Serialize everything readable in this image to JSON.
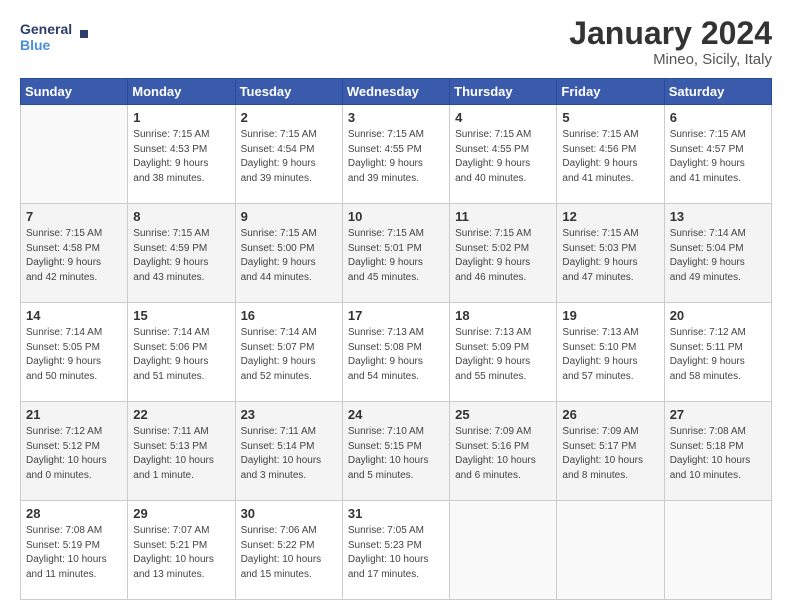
{
  "logo": {
    "line1": "General",
    "line2": "Blue"
  },
  "title": "January 2024",
  "subtitle": "Mineo, Sicily, Italy",
  "headers": [
    "Sunday",
    "Monday",
    "Tuesday",
    "Wednesday",
    "Thursday",
    "Friday",
    "Saturday"
  ],
  "weeks": [
    {
      "shade": false,
      "days": [
        {
          "num": "",
          "info": ""
        },
        {
          "num": "1",
          "info": "Sunrise: 7:15 AM\nSunset: 4:53 PM\nDaylight: 9 hours\nand 38 minutes."
        },
        {
          "num": "2",
          "info": "Sunrise: 7:15 AM\nSunset: 4:54 PM\nDaylight: 9 hours\nand 39 minutes."
        },
        {
          "num": "3",
          "info": "Sunrise: 7:15 AM\nSunset: 4:55 PM\nDaylight: 9 hours\nand 39 minutes."
        },
        {
          "num": "4",
          "info": "Sunrise: 7:15 AM\nSunset: 4:55 PM\nDaylight: 9 hours\nand 40 minutes."
        },
        {
          "num": "5",
          "info": "Sunrise: 7:15 AM\nSunset: 4:56 PM\nDaylight: 9 hours\nand 41 minutes."
        },
        {
          "num": "6",
          "info": "Sunrise: 7:15 AM\nSunset: 4:57 PM\nDaylight: 9 hours\nand 41 minutes."
        }
      ]
    },
    {
      "shade": true,
      "days": [
        {
          "num": "7",
          "info": "Sunrise: 7:15 AM\nSunset: 4:58 PM\nDaylight: 9 hours\nand 42 minutes."
        },
        {
          "num": "8",
          "info": "Sunrise: 7:15 AM\nSunset: 4:59 PM\nDaylight: 9 hours\nand 43 minutes."
        },
        {
          "num": "9",
          "info": "Sunrise: 7:15 AM\nSunset: 5:00 PM\nDaylight: 9 hours\nand 44 minutes."
        },
        {
          "num": "10",
          "info": "Sunrise: 7:15 AM\nSunset: 5:01 PM\nDaylight: 9 hours\nand 45 minutes."
        },
        {
          "num": "11",
          "info": "Sunrise: 7:15 AM\nSunset: 5:02 PM\nDaylight: 9 hours\nand 46 minutes."
        },
        {
          "num": "12",
          "info": "Sunrise: 7:15 AM\nSunset: 5:03 PM\nDaylight: 9 hours\nand 47 minutes."
        },
        {
          "num": "13",
          "info": "Sunrise: 7:14 AM\nSunset: 5:04 PM\nDaylight: 9 hours\nand 49 minutes."
        }
      ]
    },
    {
      "shade": false,
      "days": [
        {
          "num": "14",
          "info": "Sunrise: 7:14 AM\nSunset: 5:05 PM\nDaylight: 9 hours\nand 50 minutes."
        },
        {
          "num": "15",
          "info": "Sunrise: 7:14 AM\nSunset: 5:06 PM\nDaylight: 9 hours\nand 51 minutes."
        },
        {
          "num": "16",
          "info": "Sunrise: 7:14 AM\nSunset: 5:07 PM\nDaylight: 9 hours\nand 52 minutes."
        },
        {
          "num": "17",
          "info": "Sunrise: 7:13 AM\nSunset: 5:08 PM\nDaylight: 9 hours\nand 54 minutes."
        },
        {
          "num": "18",
          "info": "Sunrise: 7:13 AM\nSunset: 5:09 PM\nDaylight: 9 hours\nand 55 minutes."
        },
        {
          "num": "19",
          "info": "Sunrise: 7:13 AM\nSunset: 5:10 PM\nDaylight: 9 hours\nand 57 minutes."
        },
        {
          "num": "20",
          "info": "Sunrise: 7:12 AM\nSunset: 5:11 PM\nDaylight: 9 hours\nand 58 minutes."
        }
      ]
    },
    {
      "shade": true,
      "days": [
        {
          "num": "21",
          "info": "Sunrise: 7:12 AM\nSunset: 5:12 PM\nDaylight: 10 hours\nand 0 minutes."
        },
        {
          "num": "22",
          "info": "Sunrise: 7:11 AM\nSunset: 5:13 PM\nDaylight: 10 hours\nand 1 minute."
        },
        {
          "num": "23",
          "info": "Sunrise: 7:11 AM\nSunset: 5:14 PM\nDaylight: 10 hours\nand 3 minutes."
        },
        {
          "num": "24",
          "info": "Sunrise: 7:10 AM\nSunset: 5:15 PM\nDaylight: 10 hours\nand 5 minutes."
        },
        {
          "num": "25",
          "info": "Sunrise: 7:09 AM\nSunset: 5:16 PM\nDaylight: 10 hours\nand 6 minutes."
        },
        {
          "num": "26",
          "info": "Sunrise: 7:09 AM\nSunset: 5:17 PM\nDaylight: 10 hours\nand 8 minutes."
        },
        {
          "num": "27",
          "info": "Sunrise: 7:08 AM\nSunset: 5:18 PM\nDaylight: 10 hours\nand 10 minutes."
        }
      ]
    },
    {
      "shade": false,
      "days": [
        {
          "num": "28",
          "info": "Sunrise: 7:08 AM\nSunset: 5:19 PM\nDaylight: 10 hours\nand 11 minutes."
        },
        {
          "num": "29",
          "info": "Sunrise: 7:07 AM\nSunset: 5:21 PM\nDaylight: 10 hours\nand 13 minutes."
        },
        {
          "num": "30",
          "info": "Sunrise: 7:06 AM\nSunset: 5:22 PM\nDaylight: 10 hours\nand 15 minutes."
        },
        {
          "num": "31",
          "info": "Sunrise: 7:05 AM\nSunset: 5:23 PM\nDaylight: 10 hours\nand 17 minutes."
        },
        {
          "num": "",
          "info": ""
        },
        {
          "num": "",
          "info": ""
        },
        {
          "num": "",
          "info": ""
        }
      ]
    }
  ]
}
